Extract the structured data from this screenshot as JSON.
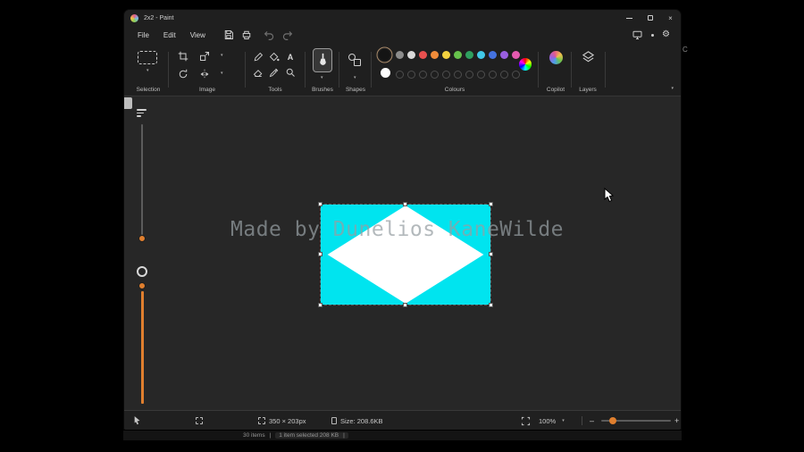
{
  "window": {
    "title": "2x2 - Paint"
  },
  "glyphs": {
    "gear": "⚙",
    "caret": "▾",
    "dot": "•",
    "close": "×",
    "minus": "–",
    "plus": "+"
  },
  "menu": {
    "items": [
      "File",
      "Edit",
      "View"
    ]
  },
  "toolbar": {
    "sections": {
      "selection": "Selection",
      "image": "Image",
      "tools": "Tools",
      "brushes": "Brushes",
      "shapes": "Shapes",
      "colours": "Colours",
      "copilot": "Copilot",
      "layers": "Layers"
    },
    "text_tool_label": "A",
    "palette": {
      "row1": [
        "#8c8c8c",
        "#d9d9d9",
        "#e8504f",
        "#f08c3a",
        "#f3d13f",
        "#67c24c",
        "#2fa05f",
        "#41c9e8",
        "#4472e0",
        "#9a5fe0",
        "#e55ab0"
      ],
      "row2": [
        null,
        null,
        null,
        null,
        null,
        null,
        null,
        null,
        null,
        null,
        null
      ]
    }
  },
  "canvas": {
    "watermark": "Made by Dunelios KaneWilde"
  },
  "colors": {
    "accent": "#e07f2e",
    "canvas_fill": "#00e4ef",
    "diamond": "#ffffff"
  },
  "status_bar": {
    "dimensions": "350 × 203px",
    "file_size": "Size: 208.6KB",
    "zoom": "100%"
  },
  "explorer_bar": {
    "items": "30 items",
    "selection": "1 item selected  208 KB",
    "separator": "|"
  },
  "fragment": {
    "letter": "C"
  }
}
